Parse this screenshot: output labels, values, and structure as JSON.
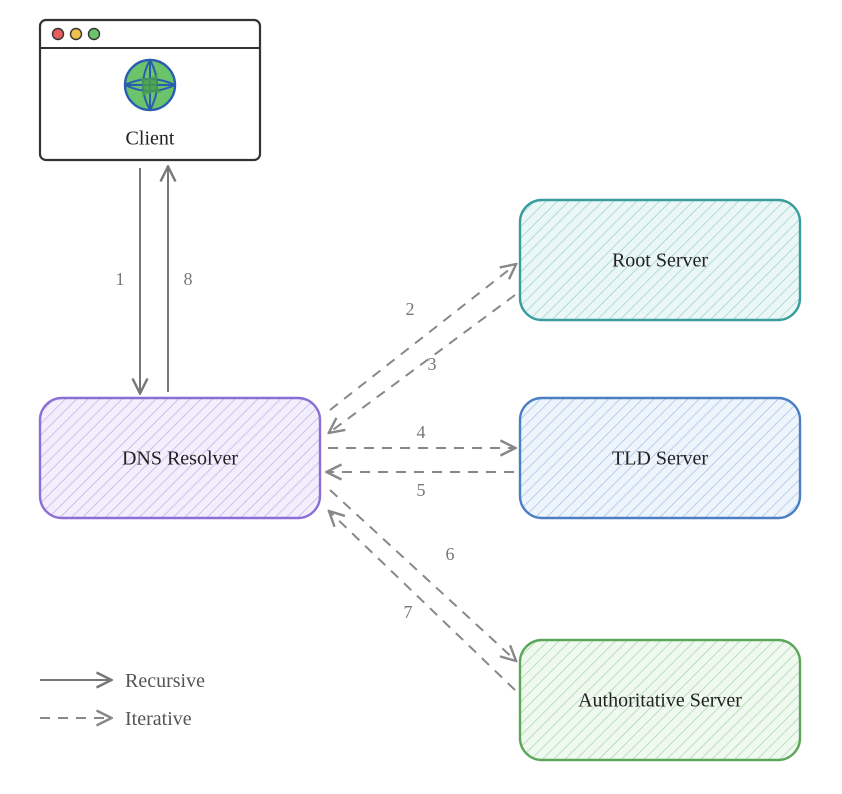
{
  "nodes": {
    "client": {
      "label": "Client"
    },
    "resolver": {
      "label": "DNS Resolver"
    },
    "root": {
      "label": "Root Server"
    },
    "tld": {
      "label": "TLD Server"
    },
    "auth": {
      "label": "Authoritative Server"
    }
  },
  "edges": {
    "e1": "1",
    "e2": "2",
    "e3": "3",
    "e4": "4",
    "e5": "5",
    "e6": "6",
    "e7": "7",
    "e8": "8"
  },
  "legend": {
    "recursive": "Recursive",
    "iterative": "Iterative"
  },
  "colors": {
    "purple_stroke": "#8b6fd6",
    "purple_fill": "#e8e0fa",
    "teal_stroke": "#3a9c9c",
    "teal_fill": "#d8f0f0",
    "blue_stroke": "#4a7fc4",
    "blue_fill": "#dce8f7",
    "green_stroke": "#5aa75a",
    "green_fill": "#e0f2e0",
    "gray": "#888888"
  }
}
